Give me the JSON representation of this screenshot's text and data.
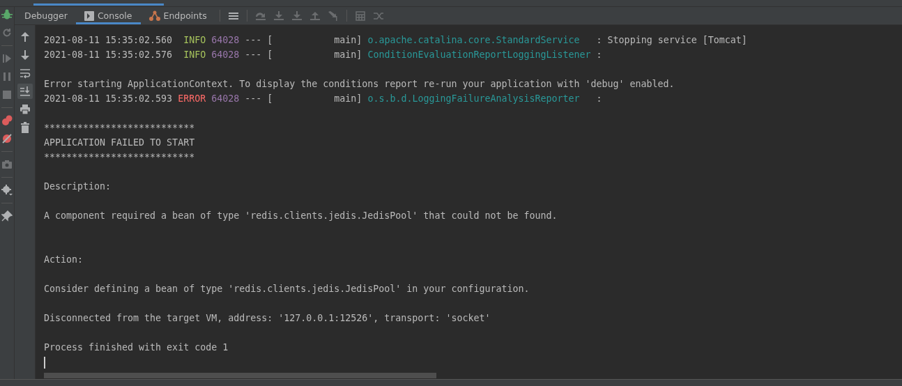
{
  "tabs": [
    {
      "label": "Debugger",
      "kind": "plain",
      "selected": false
    },
    {
      "label": "Console",
      "kind": "console",
      "selected": true
    },
    {
      "label": "Endpoints",
      "kind": "endpoints",
      "selected": false
    }
  ],
  "toolbar": [
    {
      "kind": "menu",
      "disabled": false
    },
    {
      "kind": "sep"
    },
    {
      "kind": "step-over",
      "disabled": true
    },
    {
      "kind": "step-into",
      "disabled": true
    },
    {
      "kind": "force-step-into",
      "disabled": true
    },
    {
      "kind": "step-out",
      "disabled": true
    },
    {
      "kind": "run-to-cursor",
      "disabled": true
    },
    {
      "kind": "sep"
    },
    {
      "kind": "evaluate",
      "disabled": true
    },
    {
      "kind": "trace",
      "disabled": true
    }
  ],
  "debug_tools": [
    {
      "kind": "bug",
      "disabled": false
    },
    {
      "kind": "rerun",
      "disabled": true
    },
    {
      "kind": "sep"
    },
    {
      "kind": "resume",
      "disabled": true
    },
    {
      "kind": "pause",
      "disabled": true
    },
    {
      "kind": "stop",
      "disabled": true
    },
    {
      "kind": "sep"
    },
    {
      "kind": "breakpoints",
      "disabled": false
    },
    {
      "kind": "mute",
      "disabled": false
    },
    {
      "kind": "sep"
    },
    {
      "kind": "camera",
      "disabled": true
    },
    {
      "kind": "sep"
    },
    {
      "kind": "gear",
      "disabled": false
    },
    {
      "kind": "sep"
    },
    {
      "kind": "pin",
      "disabled": false
    }
  ],
  "console_tools": [
    {
      "kind": "up",
      "selected": false
    },
    {
      "kind": "down",
      "selected": false
    },
    {
      "kind": "wrap",
      "selected": false
    },
    {
      "kind": "scroll-end",
      "selected": true
    },
    {
      "kind": "print",
      "selected": false
    },
    {
      "kind": "trash",
      "selected": false
    }
  ],
  "console_lines": [
    {
      "kind": "log",
      "timestamp": "2021-08-11 15:35:02.560",
      "level": "INFO",
      "pid": "64028",
      "separator": "---",
      "thread": "[           main]",
      "logger": "o.apache.catalina.core.StandardService",
      "message": ": Stopping service [Tomcat]"
    },
    {
      "kind": "log",
      "timestamp": "2021-08-11 15:35:02.576",
      "level": "INFO",
      "pid": "64028",
      "separator": "---",
      "thread": "[           main]",
      "logger": "ConditionEvaluationReportLoggingListener",
      "message": ":"
    },
    {
      "kind": "blank"
    },
    {
      "kind": "text",
      "text": "Error starting ApplicationContext. To display the conditions report re-run your application with 'debug' enabled."
    },
    {
      "kind": "log",
      "timestamp": "2021-08-11 15:35:02.593",
      "level": "ERROR",
      "pid": "64028",
      "separator": "---",
      "thread": "[           main]",
      "logger": "o.s.b.d.LoggingFailureAnalysisReporter",
      "message": ":"
    },
    {
      "kind": "blank"
    },
    {
      "kind": "text",
      "text": "***************************"
    },
    {
      "kind": "text",
      "text": "APPLICATION FAILED TO START"
    },
    {
      "kind": "text",
      "text": "***************************"
    },
    {
      "kind": "blank"
    },
    {
      "kind": "text",
      "text": "Description:"
    },
    {
      "kind": "blank"
    },
    {
      "kind": "text",
      "text": "A component required a bean of type 'redis.clients.jedis.JedisPool' that could not be found."
    },
    {
      "kind": "blank"
    },
    {
      "kind": "blank"
    },
    {
      "kind": "text",
      "text": "Action:"
    },
    {
      "kind": "blank"
    },
    {
      "kind": "text",
      "text": "Consider defining a bean of type 'redis.clients.jedis.JedisPool' in your configuration."
    },
    {
      "kind": "blank"
    },
    {
      "kind": "text",
      "text": "Disconnected from the target VM, address: '127.0.0.1:12526', transport: 'socket'"
    },
    {
      "kind": "blank"
    },
    {
      "kind": "text",
      "text": "Process finished with exit code 1"
    }
  ]
}
